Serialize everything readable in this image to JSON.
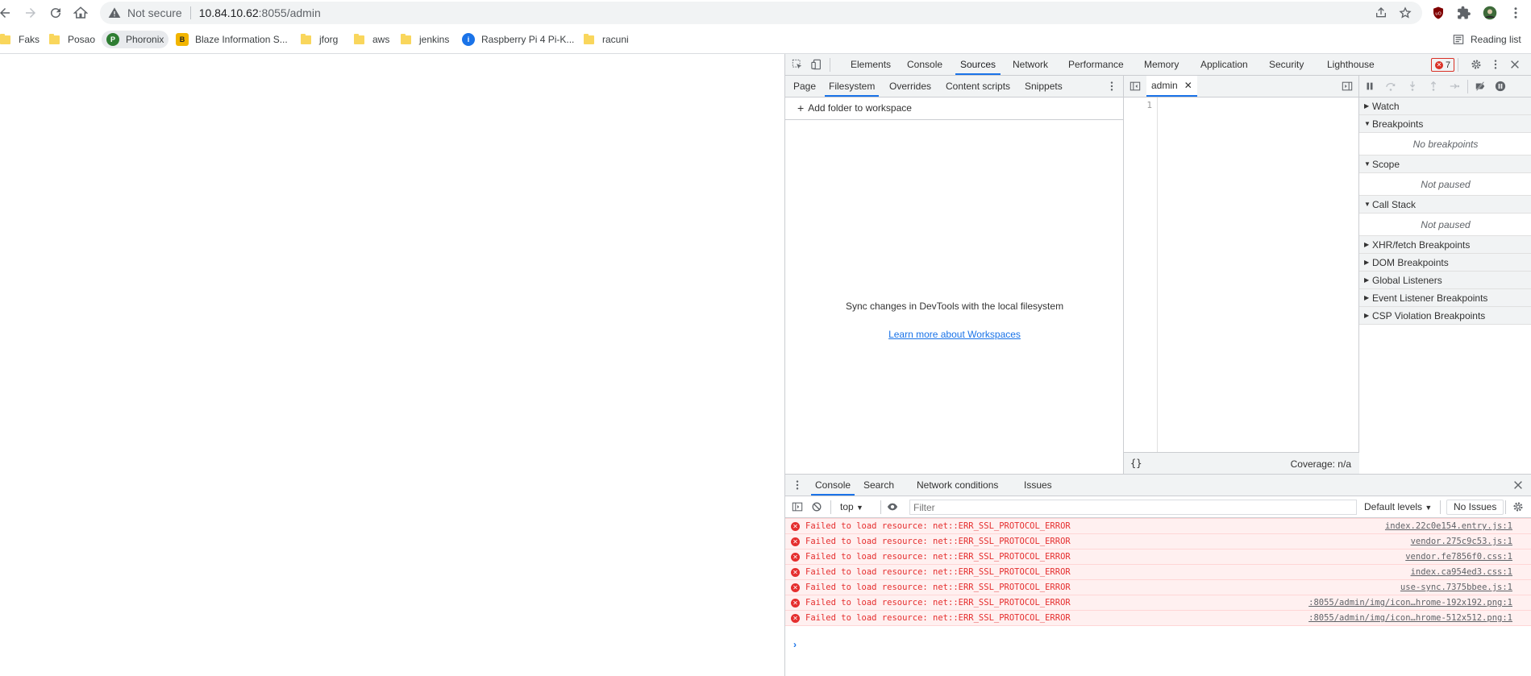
{
  "browser": {
    "omnibox": {
      "security_label": "Not secure",
      "url_host": "10.84.10.62",
      "url_path": ":8055/admin"
    },
    "bookmarks": [
      {
        "label": "Faks",
        "icon": "folder-icon"
      },
      {
        "label": "Posao",
        "icon": "folder-icon"
      },
      {
        "label": "Phoronix",
        "icon": "phoronix-icon"
      },
      {
        "label": "Blaze Information S...",
        "icon": "blaze-icon"
      },
      {
        "label": "jforg",
        "icon": "folder-icon"
      },
      {
        "label": "aws",
        "icon": "folder-icon"
      },
      {
        "label": "jenkins",
        "icon": "folder-icon"
      },
      {
        "label": "Raspberry Pi 4 Pi-K...",
        "icon": "raspberry-icon"
      },
      {
        "label": "racuni",
        "icon": "folder-icon"
      }
    ],
    "reading_list": "Reading list"
  },
  "devtools": {
    "main_tabs": [
      "Elements",
      "Console",
      "Sources",
      "Network",
      "Performance",
      "Memory",
      "Application",
      "Security",
      "Lighthouse"
    ],
    "selected_tab": "Sources",
    "error_count": "7",
    "navigator": {
      "tabs": [
        "Page",
        "Filesystem",
        "Overrides",
        "Content scripts",
        "Snippets"
      ],
      "selected": "Filesystem",
      "add_folder": "Add folder to workspace",
      "sync_text": "Sync changes in DevTools with the local filesystem",
      "learn_more": "Learn more about Workspaces"
    },
    "editor": {
      "file_tab": "admin",
      "line_number": "1",
      "pretty_print": "{}",
      "coverage": "Coverage: n/a"
    },
    "debugger": {
      "sections": [
        {
          "title": "Watch",
          "expanded": false,
          "body": ""
        },
        {
          "title": "Breakpoints",
          "expanded": true,
          "body": "No breakpoints"
        },
        {
          "title": "Scope",
          "expanded": true,
          "body": "Not paused"
        },
        {
          "title": "Call Stack",
          "expanded": true,
          "body": "Not paused"
        },
        {
          "title": "XHR/fetch Breakpoints",
          "expanded": false,
          "body": ""
        },
        {
          "title": "DOM Breakpoints",
          "expanded": false,
          "body": ""
        },
        {
          "title": "Global Listeners",
          "expanded": false,
          "body": ""
        },
        {
          "title": "Event Listener Breakpoints",
          "expanded": false,
          "body": ""
        },
        {
          "title": "CSP Violation Breakpoints",
          "expanded": false,
          "body": ""
        }
      ]
    },
    "drawer": {
      "tabs": [
        "Console",
        "Search",
        "Network conditions",
        "Issues"
      ],
      "selected": "Console",
      "context": "top",
      "filter_placeholder": "Filter",
      "levels": "Default levels",
      "no_issues": "No Issues",
      "messages": [
        {
          "text": "Failed to load resource: net::ERR_SSL_PROTOCOL_ERROR",
          "source": "index.22c0e154.entry.js:1"
        },
        {
          "text": "Failed to load resource: net::ERR_SSL_PROTOCOL_ERROR",
          "source": "vendor.275c9c53.js:1"
        },
        {
          "text": "Failed to load resource: net::ERR_SSL_PROTOCOL_ERROR",
          "source": "vendor.fe7856f0.css:1"
        },
        {
          "text": "Failed to load resource: net::ERR_SSL_PROTOCOL_ERROR",
          "source": "index.ca954ed3.css:1"
        },
        {
          "text": "Failed to load resource: net::ERR_SSL_PROTOCOL_ERROR",
          "source": "use-sync.7375bbee.js:1"
        },
        {
          "text": "Failed to load resource: net::ERR_SSL_PROTOCOL_ERROR",
          "source": ":8055/admin/img/icon…hrome-192x192.png:1"
        },
        {
          "text": "Failed to load resource: net::ERR_SSL_PROTOCOL_ERROR",
          "source": ":8055/admin/img/icon…hrome-512x512.png:1"
        }
      ],
      "prompt": "›"
    }
  },
  "colors": {
    "accent": "#1a73e8",
    "error": "#e52e2e",
    "error_bg": "#fff0f0"
  }
}
